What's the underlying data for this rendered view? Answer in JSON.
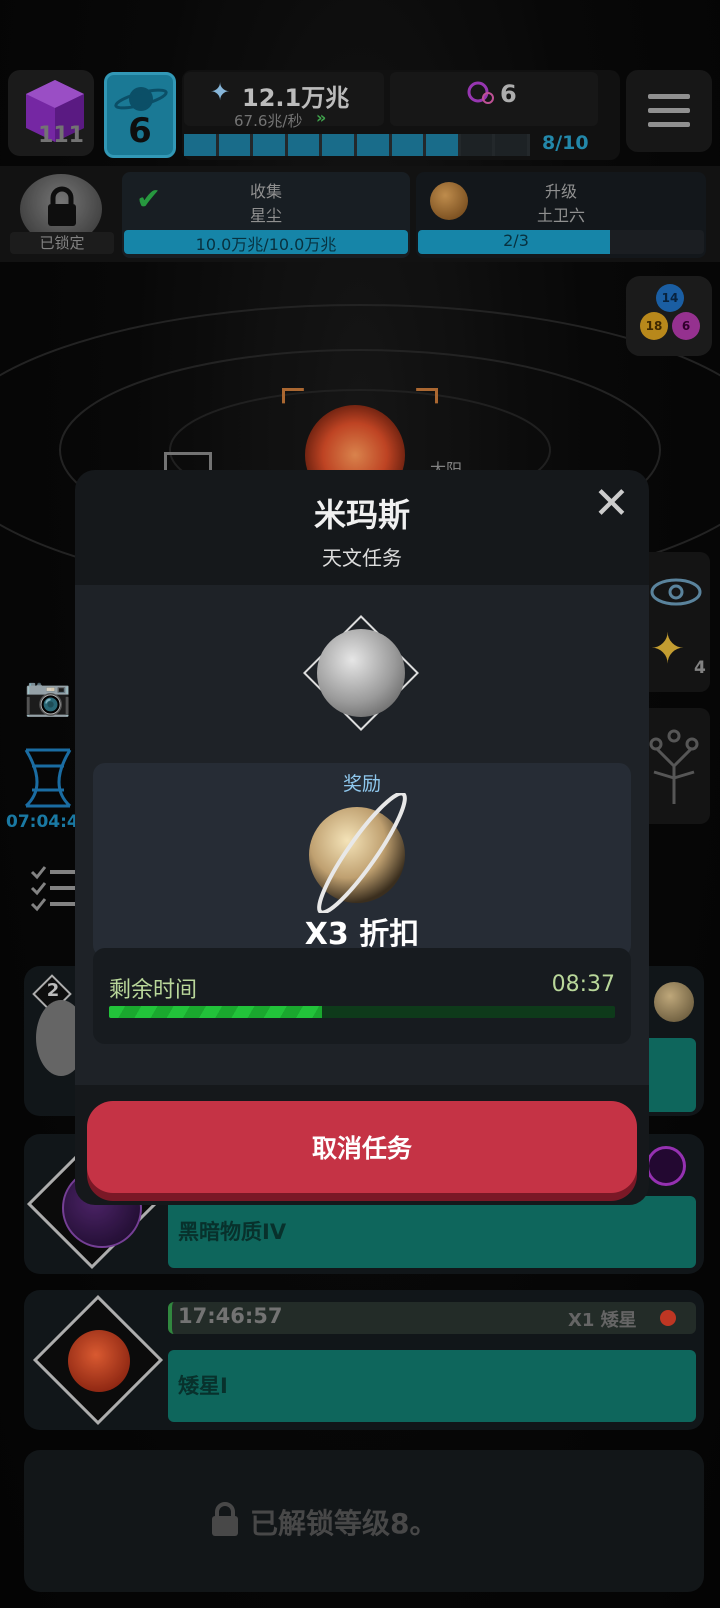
{
  "hud": {
    "cube_count": "111",
    "level": "6",
    "stardust_amount": "12.1万兆",
    "stardust_rate": "67.6兆/秒",
    "progress_text": "8/10",
    "progress_fill": 0.8,
    "dark_matter_count": "6"
  },
  "tasks_row": {
    "locked_label": "已锁定",
    "collect_title": "收集",
    "collect_subtitle": "星尘",
    "collect_progress": "10.0万兆/10.0万兆",
    "collect_fill": 1.0,
    "upgrade_title": "升级",
    "upgrade_subtitle": "土卫六",
    "upgrade_progress": "2/3",
    "upgrade_fill": 0.67
  },
  "orb_cluster": {
    "top": "14",
    "left": "18",
    "right": "6"
  },
  "scene": {
    "sun_label": "太阳",
    "timer": "07:04:4",
    "star_count": "4"
  },
  "modal": {
    "title": "米玛斯",
    "subtitle": "天文任务",
    "reward_label": "奖励",
    "reward_text": "X3 折扣",
    "remaining_label": "剩余时间",
    "remaining_time": "08:37",
    "time_fill": 0.42,
    "cancel_label": "取消任务"
  },
  "list": {
    "card1_badge": "2",
    "card2_label": "黑暗物质IV",
    "card3_timer": "17:46:57",
    "card3_reward": "X1 矮星",
    "card3_label": "矮星I",
    "locked_message": "已解锁等级8。"
  },
  "colors": {
    "accent_blue": "#1f8fb0",
    "teal": "#11786d",
    "cancel_red": "#c53345",
    "timer_green": "#22c33a",
    "reward_label_blue": "#8fc8ee"
  }
}
